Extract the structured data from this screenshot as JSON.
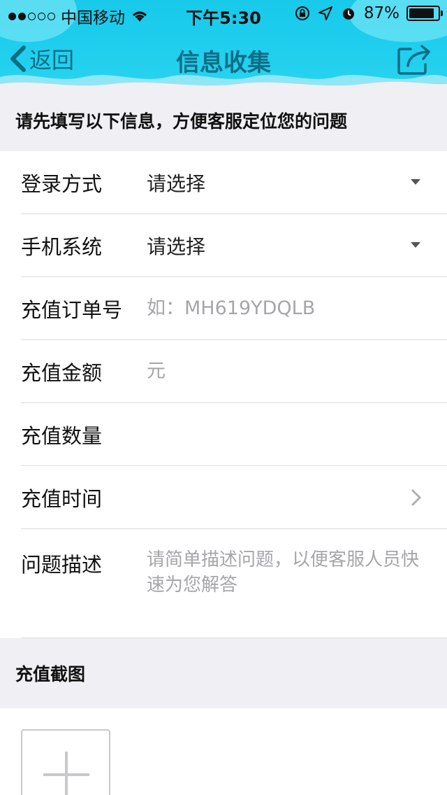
{
  "statusbar": {
    "carrier": "中国移动",
    "time": "下午5:30",
    "battery": "87%",
    "battery_level": 0.87,
    "signal_bars": 2
  },
  "navbar": {
    "back_label": "返回",
    "title": "信息收集",
    "share_icon": "share-icon"
  },
  "notice": "请先填写以下信息，方便客服定位您的问题",
  "form": {
    "login_method": {
      "label": "登录方式",
      "value": "请选择"
    },
    "phone_system": {
      "label": "手机系统",
      "value": "请选择"
    },
    "order_number": {
      "label": "充值订单号",
      "placeholder": "如：MH619YDQLB"
    },
    "amount": {
      "label": "充值金额",
      "placeholder": "元"
    },
    "quantity": {
      "label": "充值数量",
      "placeholder": ""
    },
    "time": {
      "label": "充值时间"
    },
    "description": {
      "label": "问题描述",
      "placeholder": "请简单描述问题，以便客服人员快速为您解答"
    }
  },
  "screenshot_section": {
    "title": "充值截图",
    "add_icon": "plus-icon"
  },
  "colors": {
    "header_bg": "#1ecbec",
    "nav_text": "#0d6e86",
    "placeholder": "#a6a6aa",
    "page_bg": "#efeff4"
  }
}
